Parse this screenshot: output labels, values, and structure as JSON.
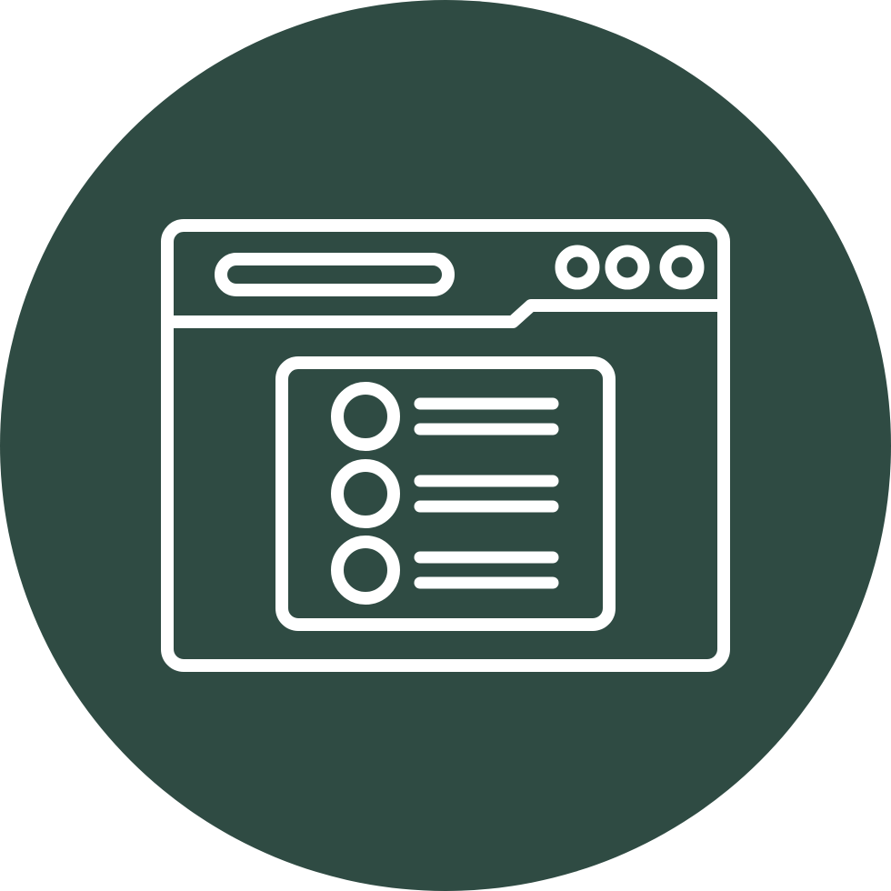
{
  "icon": {
    "name": "browser-window-list-icon",
    "background_color": "#2f4b43",
    "stroke_color": "#ffffff",
    "list_items": [
      {
        "name": "list-item-1"
      },
      {
        "name": "list-item-2"
      },
      {
        "name": "list-item-3"
      }
    ],
    "window_dots": [
      {
        "name": "window-dot-1"
      },
      {
        "name": "window-dot-2"
      },
      {
        "name": "window-dot-3"
      }
    ]
  }
}
